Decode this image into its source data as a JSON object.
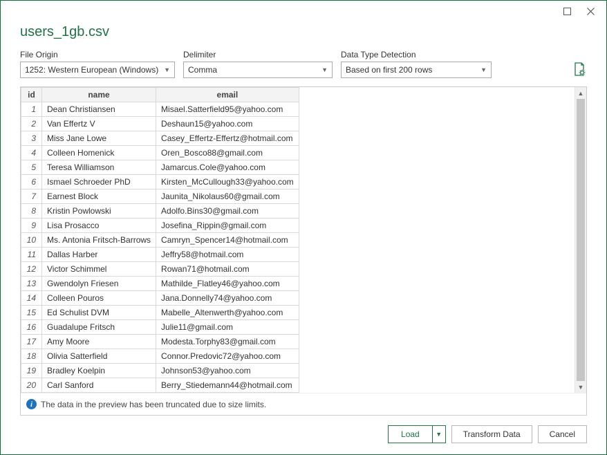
{
  "window": {
    "title": "users_1gb.csv"
  },
  "controls": {
    "file_origin": {
      "label": "File Origin",
      "value": "1252: Western European (Windows)"
    },
    "delimiter": {
      "label": "Delimiter",
      "value": "Comma"
    },
    "data_type": {
      "label": "Data Type Detection",
      "value": "Based on first 200 rows"
    }
  },
  "columns": {
    "id": "id",
    "name": "name",
    "email": "email"
  },
  "rows": [
    {
      "id": "1",
      "name": "Dean Christiansen",
      "email": "Misael.Satterfield95@yahoo.com"
    },
    {
      "id": "2",
      "name": "Van Effertz V",
      "email": "Deshaun15@yahoo.com"
    },
    {
      "id": "3",
      "name": "Miss Jane Lowe",
      "email": "Casey_Effertz-Effertz@hotmail.com"
    },
    {
      "id": "4",
      "name": "Colleen Homenick",
      "email": "Oren_Bosco88@gmail.com"
    },
    {
      "id": "5",
      "name": "Teresa Williamson",
      "email": "Jamarcus.Cole@yahoo.com"
    },
    {
      "id": "6",
      "name": "Ismael Schroeder PhD",
      "email": "Kirsten_McCullough33@yahoo.com"
    },
    {
      "id": "7",
      "name": "Earnest Block",
      "email": "Jaunita_Nikolaus60@gmail.com"
    },
    {
      "id": "8",
      "name": "Kristin Powlowski",
      "email": "Adolfo.Bins30@gmail.com"
    },
    {
      "id": "9",
      "name": "Lisa Prosacco",
      "email": "Josefina_Rippin@gmail.com"
    },
    {
      "id": "10",
      "name": "Ms. Antonia Fritsch-Barrows",
      "email": "Camryn_Spencer14@hotmail.com"
    },
    {
      "id": "11",
      "name": "Dallas Harber",
      "email": "Jeffry58@hotmail.com"
    },
    {
      "id": "12",
      "name": "Victor Schimmel",
      "email": "Rowan71@hotmail.com"
    },
    {
      "id": "13",
      "name": "Gwendolyn Friesen",
      "email": "Mathilde_Flatley46@yahoo.com"
    },
    {
      "id": "14",
      "name": "Colleen Pouros",
      "email": "Jana.Donnelly74@yahoo.com"
    },
    {
      "id": "15",
      "name": "Ed Schulist DVM",
      "email": "Mabelle_Altenwerth@yahoo.com"
    },
    {
      "id": "16",
      "name": "Guadalupe Fritsch",
      "email": "Julie11@gmail.com"
    },
    {
      "id": "17",
      "name": "Amy Moore",
      "email": "Modesta.Torphy83@gmail.com"
    },
    {
      "id": "18",
      "name": "Olivia Satterfield",
      "email": "Connor.Predovic72@yahoo.com"
    },
    {
      "id": "19",
      "name": "Bradley Koelpin",
      "email": "Johnson53@yahoo.com"
    },
    {
      "id": "20",
      "name": "Carl Sanford",
      "email": "Berry_Stiedemann44@hotmail.com"
    }
  ],
  "truncate_message": "The data in the preview has been truncated due to size limits.",
  "buttons": {
    "load": "Load",
    "transform": "Transform Data",
    "cancel": "Cancel"
  }
}
